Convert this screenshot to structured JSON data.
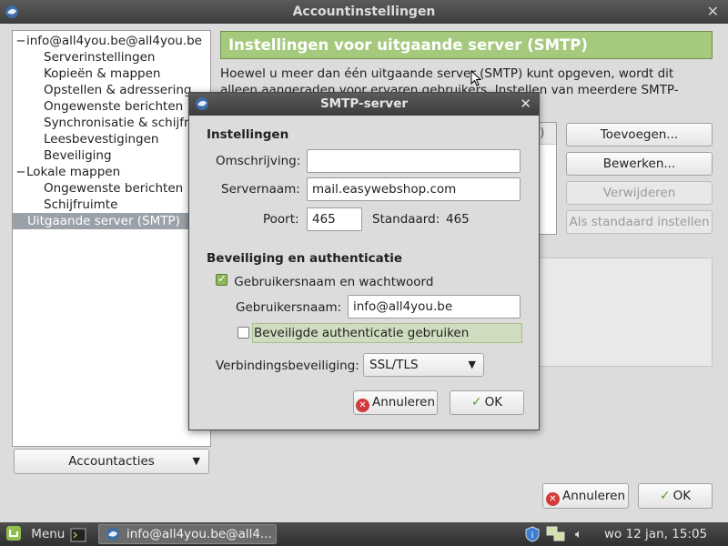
{
  "main_window": {
    "title": "Accountinstellingen",
    "close": "✕"
  },
  "tree": [
    {
      "label": "info@all4you.be@all4you.be",
      "level": 0,
      "toggle": "−"
    },
    {
      "label": "Serverinstellingen",
      "level": 1
    },
    {
      "label": "Kopieën & mappen",
      "level": 1
    },
    {
      "label": "Opstellen & adressering",
      "level": 1
    },
    {
      "label": "Ongewenste berichten",
      "level": 1
    },
    {
      "label": "Synchronisatie & schijfruimte",
      "level": 1
    },
    {
      "label": "Leesbevestigingen",
      "level": 1
    },
    {
      "label": "Beveiliging",
      "level": 1
    },
    {
      "label": "Lokale mappen",
      "level": 0,
      "toggle": "−"
    },
    {
      "label": "Ongewenste berichten",
      "level": 1
    },
    {
      "label": "Schijfruimte",
      "level": 1
    },
    {
      "label": "Uitgaande server (SMTP)",
      "level": 0,
      "selected": true
    }
  ],
  "account_actions": {
    "label": "Accountacties"
  },
  "smtp_panel": {
    "header": "Instellingen voor uitgaande server (SMTP)",
    "description": "Hoewel u meer dan één uitgaande server (SMTP) kunt opgeven, wordt dit alleen aangeraden voor ervaren gebruikers. Instellen van meerdere SMTP-servers kan",
    "list_header": "d)",
    "buttons": {
      "add": "Toevoegen...",
      "edit": "Bewerken...",
      "remove": "Verwijderen",
      "set_default": "Als standaard instellen"
    }
  },
  "main_footer": {
    "cancel": "Annuleren",
    "ok": "OK"
  },
  "dialog": {
    "title": "SMTP-server",
    "close": "✕",
    "settings_title": "Instellingen",
    "description_label": "Omschrijving:",
    "description_value": "",
    "server_label": "Servernaam:",
    "server_value": "mail.easywebshop.com",
    "port_label": "Poort:",
    "port_value": "465",
    "default_label": "Standaard:",
    "default_value": "465",
    "security_title": "Beveiliging en authenticatie",
    "use_auth_label": "Gebruikersnaam en wachtwoord",
    "use_auth_checked": true,
    "username_label": "Gebruikersnaam:",
    "username_value": "info@all4you.be",
    "secure_auth_label": "Beveiligde authenticatie gebruiken",
    "secure_auth_checked": false,
    "conn_security_label": "Verbindingsbeveiliging:",
    "conn_security_value": "SSL/TLS",
    "cancel": "Annuleren",
    "ok": "OK"
  },
  "taskbar": {
    "menu_label": "Menu",
    "window_label": "info@all4you.be@all4...",
    "clock": "wo 12 jan, 15:05 uur"
  },
  "colors": {
    "header_green": "#a5c97d",
    "titlebar": "#3d3d3d",
    "selection": "#9aa1a8"
  }
}
